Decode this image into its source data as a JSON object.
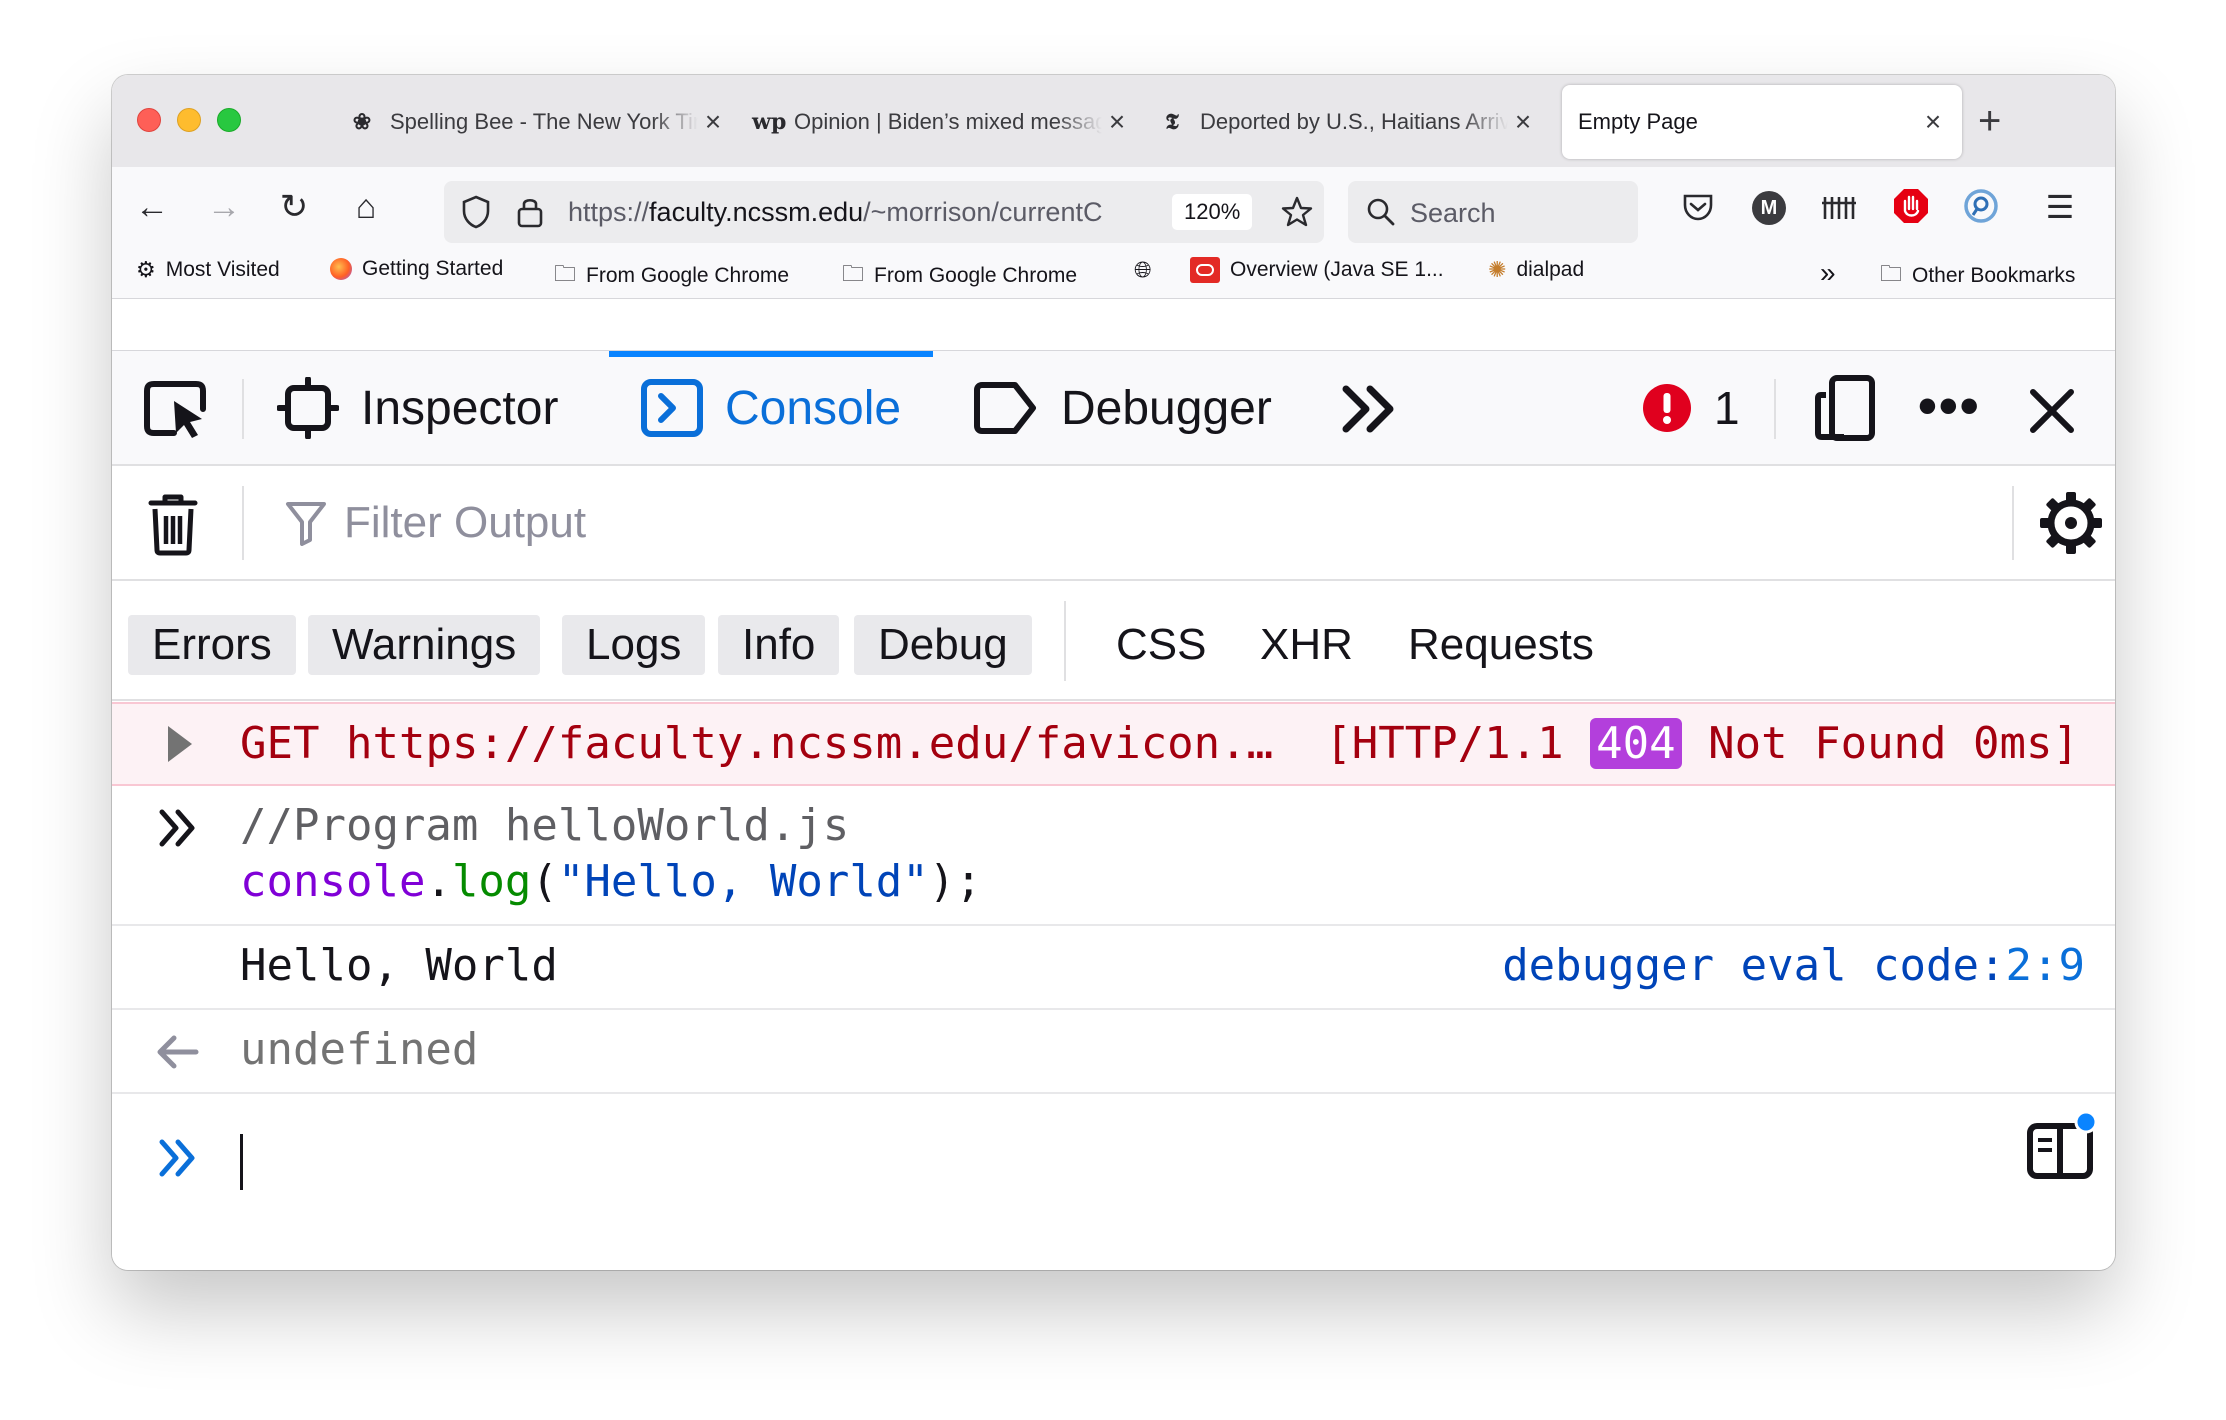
{
  "tabs": [
    {
      "icon": "bee-icon",
      "title": "Spelling Bee - The New York Times"
    },
    {
      "icon": "wp-icon",
      "title": "Opinion | Biden’s mixed messages"
    },
    {
      "icon": "nyt-icon",
      "title": "Deported by U.S., Haitians Arrive"
    },
    {
      "icon": "",
      "title": "Empty Page"
    }
  ],
  "nav": {
    "url": "https://faculty.ncssm.edu/~morrison/currentCourses",
    "url_prefix": "https://",
    "url_host": "faculty.ncssm.edu",
    "url_path": "/~morrison/currentC",
    "zoom": "120%",
    "search_placeholder": "Search"
  },
  "bookmarks": [
    {
      "icon": "gear-icon",
      "label": "Most Visited"
    },
    {
      "icon": "firefox-icon",
      "label": "Getting Started"
    },
    {
      "icon": "folder-icon",
      "label": "From Google Chrome"
    },
    {
      "icon": "folder-icon",
      "label": "From Google Chrome"
    },
    {
      "icon": "globe-icon",
      "label": ""
    },
    {
      "icon": "oracle-icon",
      "label": "Overview (Java SE 1..."
    },
    {
      "icon": "dialpad-icon",
      "label": "dialpad"
    },
    {
      "icon": "folder-icon",
      "label": "Other Bookmarks"
    }
  ],
  "devtools": {
    "tabs": [
      "Inspector",
      "Console",
      "Debugger"
    ],
    "selected_tab": "Console",
    "error_count": "1",
    "filter_placeholder": "Filter Output",
    "levels": [
      "Errors",
      "Warnings",
      "Logs",
      "Info",
      "Debug"
    ],
    "categories": [
      "CSS",
      "XHR",
      "Requests"
    ]
  },
  "console": {
    "error": {
      "method": "GET",
      "url": "https://faculty.ncssm.edu/favicon.…",
      "protocol": "[HTTP/1.1",
      "status": "404",
      "status_text": "Not Found 0ms]"
    },
    "input": {
      "comment": "//Program helloWorld.js",
      "obj": "console",
      "dot": ".",
      "fn": "log",
      "open": "(",
      "str": "\"Hello, World\"",
      "close": ");"
    },
    "output": {
      "text": "Hello, World",
      "location": "debugger eval code:",
      "location_pos": "2:9"
    },
    "result": "undefined"
  },
  "colors": {
    "accent": "#0a84ff",
    "error_text": "#a4000f",
    "error_bg": "#fdf2f5",
    "status_badge": "#b33fdc"
  }
}
